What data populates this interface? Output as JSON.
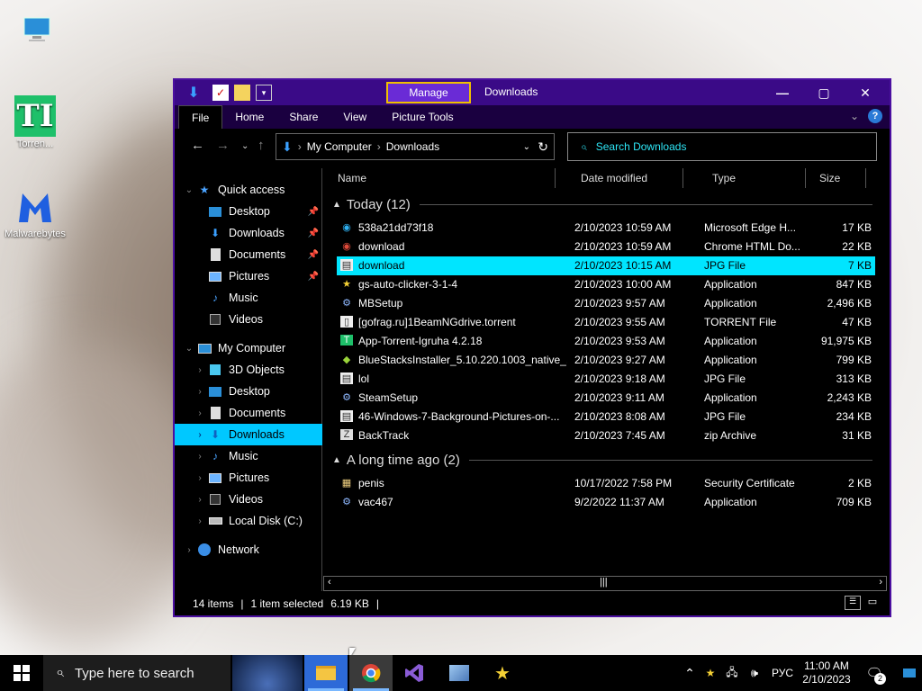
{
  "desktop": {
    "icons": [
      {
        "label": ""
      },
      {
        "label": "Torren..."
      },
      {
        "label": "Malwarebytes"
      }
    ]
  },
  "window": {
    "manage_label": "Manage",
    "title": "Downloads",
    "ribbon_tabs": [
      "File",
      "Home",
      "Share",
      "View",
      "Picture Tools"
    ],
    "breadcrumb": [
      "My Computer",
      "Downloads"
    ],
    "search_placeholder": "Search Downloads",
    "nav": {
      "quick_access": "Quick access",
      "quick_items": [
        "Desktop",
        "Downloads",
        "Documents",
        "Pictures",
        "Music",
        "Videos"
      ],
      "my_computer": "My Computer",
      "computer_items": [
        "3D Objects",
        "Desktop",
        "Documents",
        "Downloads",
        "Music",
        "Pictures",
        "Videos",
        "Local Disk (C:)"
      ],
      "network": "Network"
    },
    "columns": [
      "Name",
      "Date modified",
      "Type",
      "Size"
    ],
    "groups": [
      {
        "title": "Today (12)",
        "files": [
          {
            "name": "538a21dd73f18",
            "date": "2/10/2023 10:59 AM",
            "type": "Microsoft Edge H...",
            "size": "17 KB",
            "icon": "edge-icon"
          },
          {
            "name": "download",
            "date": "2/10/2023 10:59 AM",
            "type": "Chrome HTML Do...",
            "size": "22 KB",
            "icon": "chrome-icon"
          },
          {
            "name": "download",
            "date": "2/10/2023 10:15 AM",
            "type": "JPG File",
            "size": "7 KB",
            "icon": "jpg-file-icon"
          },
          {
            "name": "gs-auto-clicker-3-1-4",
            "date": "2/10/2023 10:00 AM",
            "type": "Application",
            "size": "847 KB",
            "icon": "star-icon"
          },
          {
            "name": "MBSetup",
            "date": "2/10/2023 9:57 AM",
            "type": "Application",
            "size": "2,496 KB",
            "icon": "setup-icon"
          },
          {
            "name": "[gofrag.ru]1BeamNGdrive.torrent",
            "date": "2/10/2023 9:55 AM",
            "type": "TORRENT File",
            "size": "47 KB",
            "icon": "file-icon"
          },
          {
            "name": "App-Torrent-Igruha 4.2.18",
            "date": "2/10/2023 9:53 AM",
            "type": "Application",
            "size": "91,975 KB",
            "icon": "torrent-app-icon"
          },
          {
            "name": "BlueStacksInstaller_5.10.220.1003_native_...",
            "date": "2/10/2023 9:27 AM",
            "type": "Application",
            "size": "799 KB",
            "icon": "bluestacks-icon"
          },
          {
            "name": "lol",
            "date": "2/10/2023 9:18 AM",
            "type": "JPG File",
            "size": "313 KB",
            "icon": "jpg-file-icon"
          },
          {
            "name": "SteamSetup",
            "date": "2/10/2023 9:11 AM",
            "type": "Application",
            "size": "2,243 KB",
            "icon": "steam-icon"
          },
          {
            "name": "46-Windows-7-Background-Pictures-on-...",
            "date": "2/10/2023 8:08 AM",
            "type": "JPG File",
            "size": "234 KB",
            "icon": "jpg-file-icon"
          },
          {
            "name": "BackTrack",
            "date": "2/10/2023 7:45 AM",
            "type": "zip Archive",
            "size": "31 KB",
            "icon": "zip-icon"
          }
        ]
      },
      {
        "title": "A long time ago (2)",
        "files": [
          {
            "name": "penis",
            "date": "10/17/2022 7:58 PM",
            "type": "Security Certificate",
            "size": "2 KB",
            "icon": "certificate-icon"
          },
          {
            "name": "vac467",
            "date": "9/2/2022 11:37 AM",
            "type": "Application",
            "size": "709 KB",
            "icon": "setup-icon"
          }
        ]
      }
    ],
    "status": {
      "count": "14 items",
      "selected": "1 item selected",
      "size": "6.19 KB"
    }
  },
  "taskbar": {
    "search_placeholder": "Type here to search",
    "language": "РУС",
    "time": "11:00 AM",
    "date": "2/10/2023",
    "notification_count": "2"
  }
}
